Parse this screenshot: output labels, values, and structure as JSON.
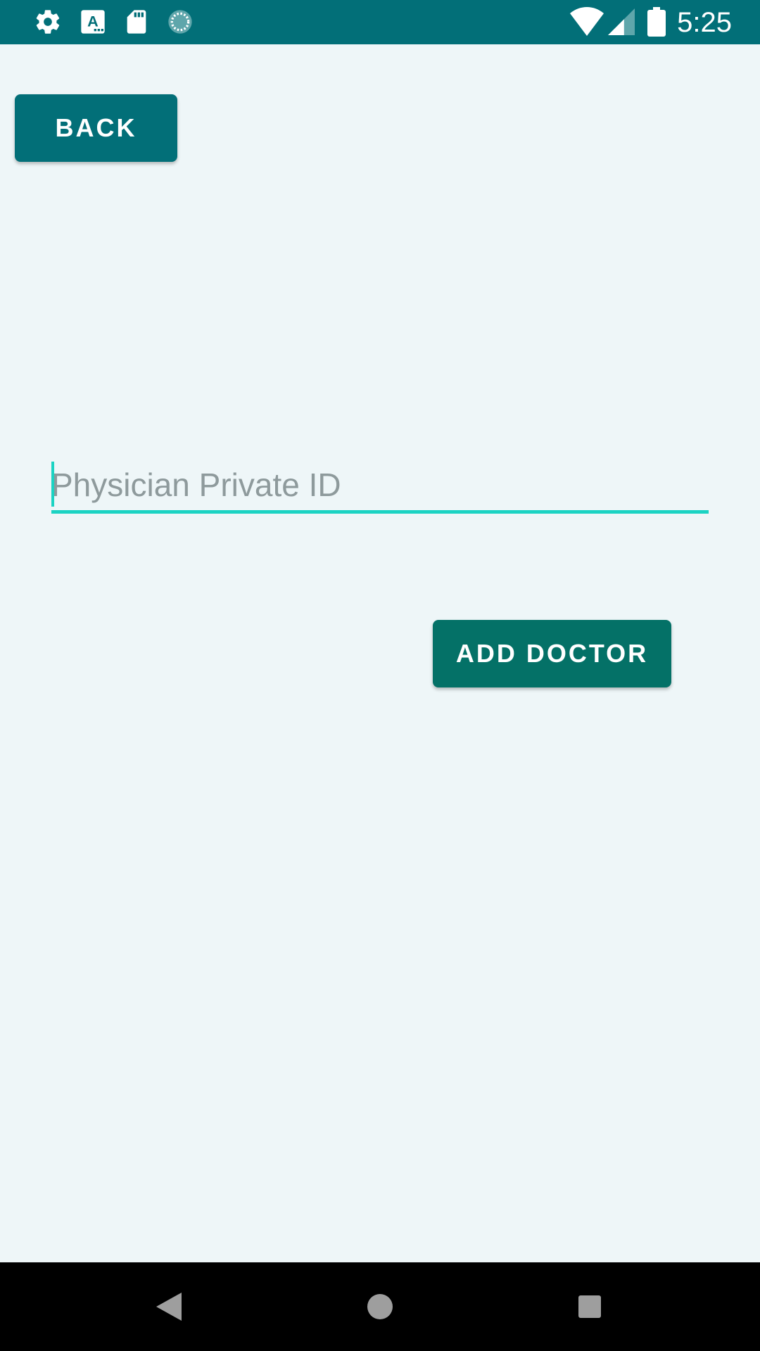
{
  "status_bar": {
    "time": "5:25",
    "icons": [
      "settings-icon",
      "text-a-icon",
      "sd-card-icon",
      "sync-icon",
      "wifi-icon",
      "signal-icon",
      "battery-icon"
    ],
    "color": "#026f78"
  },
  "toolbar": {
    "back_label": "BACK"
  },
  "form": {
    "physician_id": {
      "placeholder": "Physician Private ID",
      "value": ""
    },
    "add_label": "ADD DOCTOR"
  },
  "colors": {
    "primary": "#026f78",
    "accent": "#1bd3c3",
    "add_button": "#047167",
    "background": "#eef6f8"
  },
  "nav_bar": {
    "icons": [
      "back-triangle-icon",
      "home-circle-icon",
      "recents-square-icon"
    ]
  }
}
